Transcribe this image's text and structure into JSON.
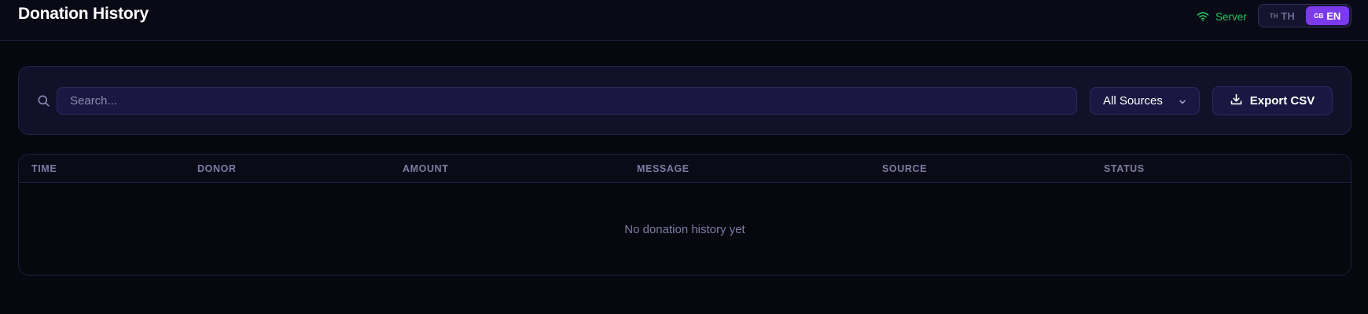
{
  "header": {
    "title": "Donation History",
    "server_status": "Server",
    "languages": [
      {
        "flag": "TH",
        "label": "TH",
        "active": false
      },
      {
        "flag": "GB",
        "label": "EN",
        "active": true
      }
    ]
  },
  "filters": {
    "search_placeholder": "Search...",
    "search_value": "",
    "source_selected": "All Sources",
    "export_label": "Export CSV"
  },
  "table": {
    "columns": [
      "TIME",
      "DONOR",
      "AMOUNT",
      "MESSAGE",
      "SOURCE",
      "STATUS"
    ],
    "rows": [],
    "empty_message": "No donation history yet"
  },
  "colors": {
    "accent": "#7c3aed",
    "server_online": "#22c55e",
    "background": "#07070f",
    "card": "#12112a"
  },
  "icons": {
    "server": "wifi-icon",
    "search": "search-icon",
    "select": "chevron-down-icon",
    "export": "download-icon"
  }
}
